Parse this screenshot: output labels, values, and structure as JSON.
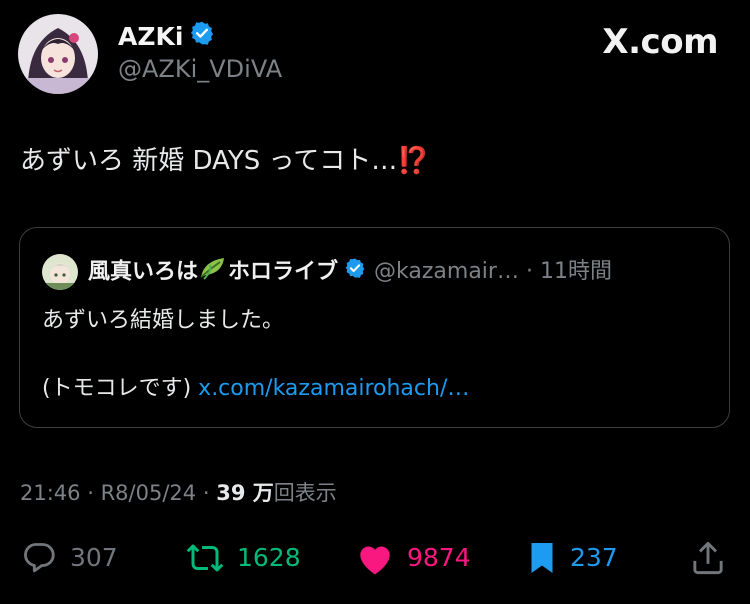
{
  "author": {
    "display_name": "AZKi",
    "handle": "@AZKi_VDiVA",
    "verified": true
  },
  "brand": {
    "logo_text": "X.com"
  },
  "tweet": {
    "text": "あずいろ 新婚 DAYS ってコト…",
    "emoji": "⁉️"
  },
  "quote": {
    "name": "風真いろは",
    "name_suffix": "ホロライブ",
    "name_emoji": "leaf-emoji",
    "handle_and_time": "@kazamair… · 11時間",
    "text_line1": "あずいろ結婚しました。",
    "text_line2_prefix": "(トモコレです) ",
    "link_text": "x.com/kazamairohach/…"
  },
  "meta": {
    "time": "21:46",
    "separator": "·",
    "date": "R8/05/24",
    "views_count": "39 万",
    "views_label": "回表示"
  },
  "actions": {
    "reply": {
      "icon": "reply-icon",
      "count": "307",
      "color": "#71767b"
    },
    "retweet": {
      "icon": "retweet-icon",
      "count": "1628",
      "color": "#00ba7c"
    },
    "like": {
      "icon": "heart-icon",
      "count": "9874",
      "color": "#f91880"
    },
    "bookmark": {
      "icon": "bookmark-icon",
      "count": "237",
      "color": "#1d9bf0"
    },
    "share": {
      "icon": "share-icon"
    }
  },
  "colors": {
    "background": "#000000",
    "text": "#e7e9ea",
    "muted": "#71767b",
    "link": "#1d9bf0",
    "verified": "#1d9bf0"
  }
}
